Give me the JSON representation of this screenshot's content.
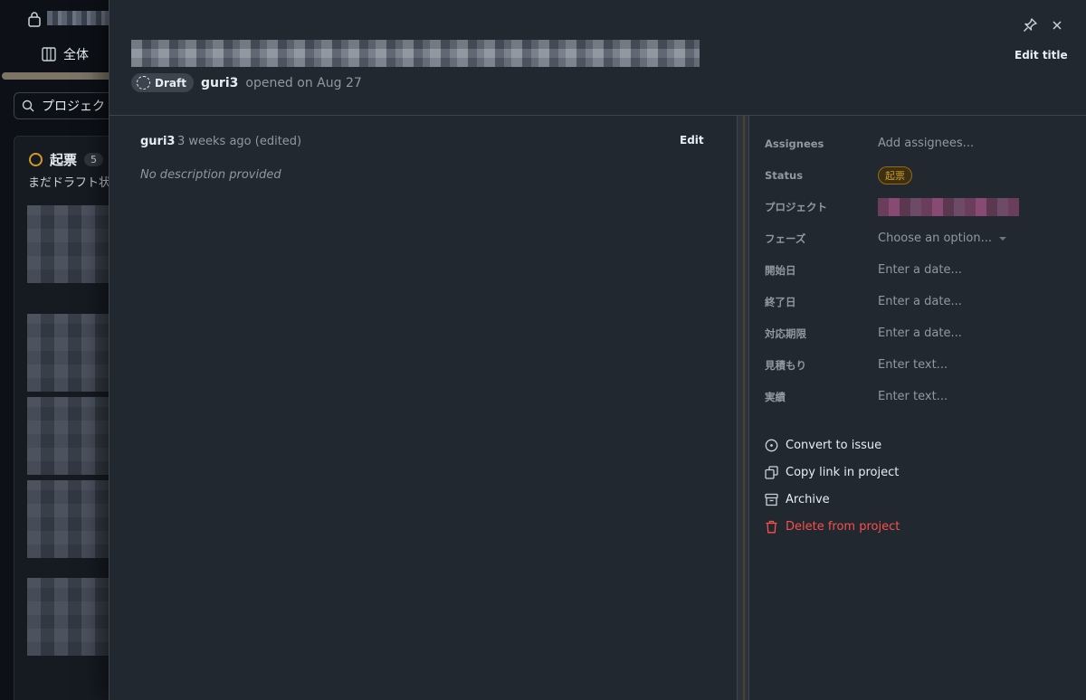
{
  "background": {
    "tab_label": "全体",
    "search_placeholder": "プロジェクト",
    "column": {
      "title": "起票",
      "count": "5",
      "description": "まだドラフト状"
    }
  },
  "header": {
    "badge_label": "Draft",
    "author": "guri3",
    "opened_text": "opened on Aug 27",
    "edit_title_label": "Edit title"
  },
  "comment": {
    "author": "guri3",
    "time": "3 weeks ago (edited)",
    "edit_label": "Edit",
    "body": "No description provided"
  },
  "fields": {
    "assignees": {
      "label": "Assignees",
      "value": "Add assignees..."
    },
    "status": {
      "label": "Status",
      "value": "起票"
    },
    "project": {
      "label": "プロジェクト"
    },
    "phase": {
      "label": "フェーズ",
      "value": "Choose an option..."
    },
    "start_date": {
      "label": "開始日",
      "value": "Enter a date..."
    },
    "end_date": {
      "label": "終了日",
      "value": "Enter a date..."
    },
    "due_date": {
      "label": "対応期限",
      "value": "Enter a date..."
    },
    "estimate": {
      "label": "見積もり",
      "value": "Enter text..."
    },
    "actual": {
      "label": "実績",
      "value": "Enter text..."
    }
  },
  "actions": {
    "convert": "Convert to issue",
    "copy_link": "Copy link in project",
    "archive": "Archive",
    "delete": "Delete from project"
  },
  "colors": {
    "panel_bg": "#212830",
    "status_accent": "#d29922",
    "danger": "#f85149"
  }
}
